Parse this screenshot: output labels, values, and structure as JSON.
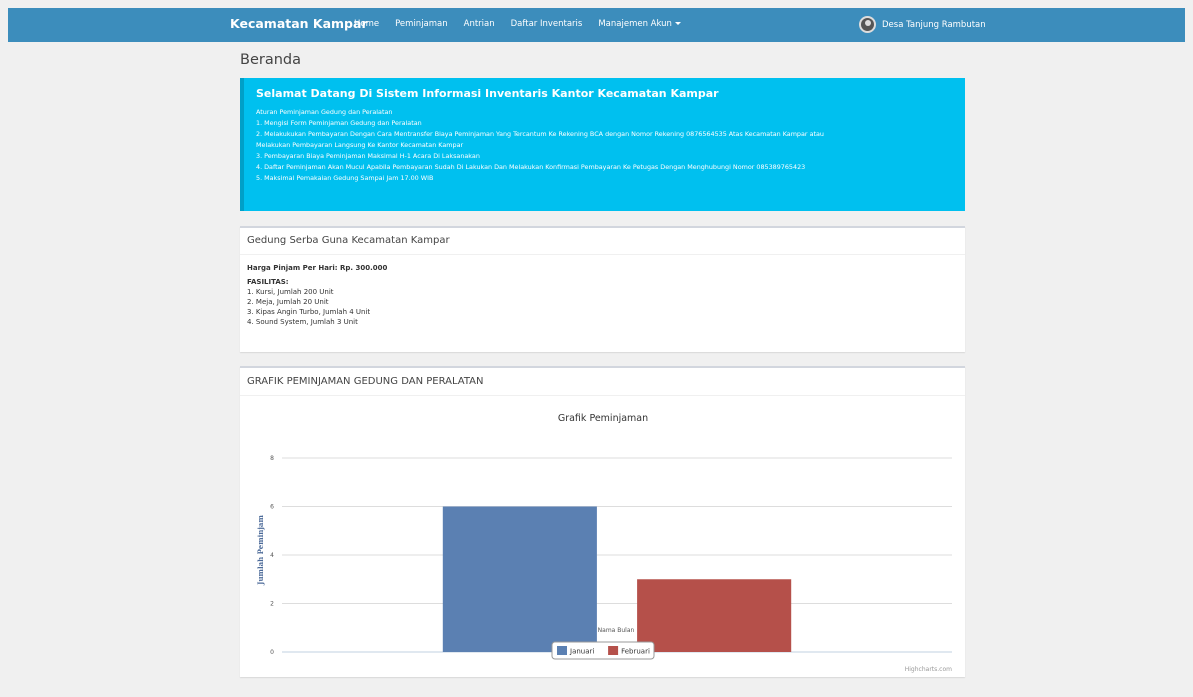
{
  "navbar": {
    "brand": "Kecamatan Kampar",
    "items": [
      {
        "label": "Home"
      },
      {
        "label": "Peminjaman"
      },
      {
        "label": "Antrian"
      },
      {
        "label": "Daftar Inventaris"
      },
      {
        "label": "Manajemen Akun"
      }
    ],
    "user": "Desa Tanjung Rambutan"
  },
  "page_title": "Beranda",
  "callout": {
    "title": "Selamat Datang Di Sistem Informasi Inventaris Kantor Kecamatan Kampar",
    "lines": [
      "Aturan Peminjaman Gedung dan Peralatan",
      "1. Mengisi Form Peminjaman Gedung dan Peralatan",
      "2. Melakukukan Pembayaran Dengan Cara Mentransfer Biaya Peminjaman Yang Tercantum Ke Rekening BCA dengan Nomor Rekening 0876564535 Atas Kecamatan Kampar atau",
      "Melakukan Pembayaran Langsung Ke Kantor Kecamatan Kampar",
      "3. Pembayaran Biaya Peminjaman Maksimal H-1 Acara Di Laksanakan",
      "4. Daftar Peminjaman Akan Mucul Apabila Pembayaran Sudah Di Lakukan Dan Melakukan Konfirmasi Pembayaran Ke Petugas Dengan Menghubungi Nomor 085389765423",
      "5. Maksimal Pemakaian Gedung Sampai Jam 17.00 WIB"
    ]
  },
  "gedung": {
    "title": "Gedung Serba Guna Kecamatan Kampar",
    "price": "Harga Pinjam Per Hari: Rp. 300.000",
    "facilities_title": "FASILITAS:",
    "facilities": [
      "1. Kursi, Jumlah 200 Unit",
      "2. Meja, Jumlah 20 Unit",
      "3. Kipas Angin Turbo, Jumlah 4 Unit",
      "4. Sound System, Jumlah 3 Unit"
    ]
  },
  "chart_box": {
    "title": "GRAFIK PEMINJAMAN GEDUNG DAN PERALATAN",
    "credit": "Highcharts.com"
  },
  "chart_data": {
    "type": "bar",
    "title": "Grafik Peminjaman",
    "xlabel": "Nama Bulan",
    "ylabel": "Jumlah Peminjam",
    "ylim": [
      0,
      8
    ],
    "yticks": [
      0,
      2,
      4,
      6,
      8
    ],
    "grid": true,
    "legend_placement": "bottom-center",
    "series": [
      {
        "name": "Januari",
        "values": [
          6
        ],
        "color": "#5b80b2"
      },
      {
        "name": "Februari",
        "values": [
          3
        ],
        "color": "#b5504a"
      }
    ]
  }
}
